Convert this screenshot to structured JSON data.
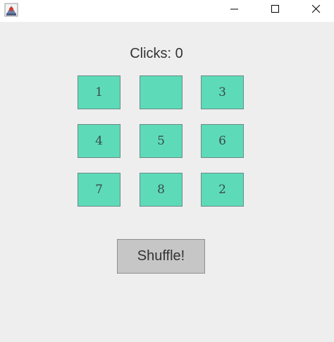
{
  "window": {
    "app_icon": "java-app-icon",
    "controls": {
      "minimize_icon": "minimize-icon",
      "maximize_icon": "maximize-icon",
      "close_icon": "close-icon"
    }
  },
  "game": {
    "clicks_text": "Clicks: 0",
    "tiles": [
      "1",
      "",
      "3",
      "4",
      "5",
      "6",
      "7",
      "8",
      "2"
    ],
    "shuffle_label": "Shuffle!"
  },
  "colors": {
    "tile_bg": "#5ddbb8",
    "tile_border": "#6b8b86",
    "window_bg": "#eeeeee",
    "button_bg": "#c6c6c6"
  }
}
